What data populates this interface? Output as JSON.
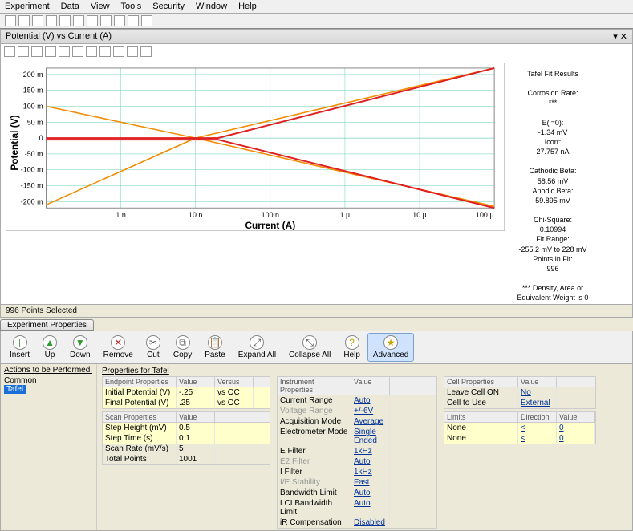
{
  "menu": [
    "Experiment",
    "Data",
    "View",
    "Tools",
    "Security",
    "Window",
    "Help"
  ],
  "chart_panel_title": "Potential (V) vs Current (A)",
  "chart_close": "▾ ✕",
  "status_points": "996 Points Selected",
  "chart_data": {
    "type": "line",
    "title": "",
    "xlabel": "Current (A)",
    "ylabel": "Potential (V)",
    "x_ticks": [
      "1 n",
      "10 n",
      "100 n",
      "1 µ",
      "10 µ",
      "100 µ"
    ],
    "y_ticks": [
      "200 m",
      "150 m",
      "100 m",
      "50 m",
      "0",
      "-50 m",
      "-100 m",
      "-150 m",
      "-200 m"
    ],
    "ylim": [
      -0.25,
      0.25
    ],
    "xscale": "log",
    "series": [
      {
        "name": "Tafel data (orange)",
        "color": "#f28c00",
        "shape": "v-down",
        "apex_x": "~30 n",
        "apex_y": 0,
        "left_end_y": 0.1,
        "right_end_y": 0.24,
        "left_end_y_neg": -0.23,
        "right_end_y_neg": -0.24
      },
      {
        "name": "Tafel fit (red)",
        "color": "#e02020",
        "shape": "v-down",
        "apex_x": "~40 n",
        "apex_y": 0,
        "left_flat_y": 0,
        "right_end_y": 0.24,
        "right_end_y_neg": -0.24
      }
    ]
  },
  "results": {
    "header": "Tafel Fit Results",
    "items": [
      {
        "l": "Corrosion Rate:",
        "v": "***"
      },
      {
        "l": "E(i=0):",
        "v": "-1.34 mV"
      },
      {
        "l": "Icorr:",
        "v": "27.757 nA"
      },
      {
        "l": "Cathodic Beta:",
        "v": "58.56 mV"
      },
      {
        "l": "Anodic Beta:",
        "v": "59.895 mV"
      },
      {
        "l": "Chi-Square:",
        "v": "0.10994"
      },
      {
        "l": "Fit Range:",
        "v": "-255.2 mV to 228 mV"
      },
      {
        "l": "Points in Fit:",
        "v": "996"
      }
    ],
    "footnote": "*** Density, Area or Equivalent Weight is 0"
  },
  "props_tab": "Experiment Properties",
  "props_buttons": [
    {
      "label": "Insert",
      "icon": "＋",
      "c": "#2a9c2a"
    },
    {
      "label": "Up",
      "icon": "▲",
      "c": "#2a9c2a"
    },
    {
      "label": "Down",
      "icon": "▼",
      "c": "#2a9c2a"
    },
    {
      "label": "Remove",
      "icon": "✕",
      "c": "#c02020"
    },
    {
      "label": "Cut",
      "icon": "✂",
      "c": "#555"
    },
    {
      "label": "Copy",
      "icon": "⧉",
      "c": "#555"
    },
    {
      "label": "Paste",
      "icon": "📋",
      "c": "#555"
    },
    {
      "label": "Expand All",
      "icon": "⤢",
      "c": "#555"
    },
    {
      "label": "Collapse All",
      "icon": "⤡",
      "c": "#555"
    },
    {
      "label": "Help",
      "icon": "?",
      "c": "#c9a400"
    },
    {
      "label": "Advanced",
      "icon": "★",
      "c": "#c9a400",
      "sel": true
    }
  ],
  "tree": {
    "header": "Actions to be Performed:",
    "root": "Common",
    "child": "Tafel"
  },
  "properties_title": "Properties for Tafel",
  "groups": {
    "endpoint": {
      "header": "Endpoint Properties",
      "cols": [
        "Value",
        "Versus"
      ],
      "rows": [
        {
          "n": "Initial Potential (V)",
          "v": "-.25",
          "x": "vs OC",
          "e": true
        },
        {
          "n": "Final Potential (V)",
          "v": ".25",
          "x": "vs OC",
          "e": true
        }
      ]
    },
    "scan": {
      "header": "Scan Properties",
      "cols": [
        "Value"
      ],
      "rows": [
        {
          "n": "Step Height (mV)",
          "v": "0.5",
          "e": true
        },
        {
          "n": "Step Time (s)",
          "v": "0.1",
          "e": true
        },
        {
          "n": "Scan Rate (mV/s)",
          "v": "5"
        },
        {
          "n": "Total Points",
          "v": "1001"
        }
      ]
    },
    "instr": {
      "header": "Instrument Properties",
      "cols": [
        "Value"
      ],
      "rows": [
        {
          "n": "Current Range",
          "v": "Auto",
          "link": true
        },
        {
          "n": "Voltage Range",
          "v": "+/-6V",
          "link": true,
          "dis": true
        },
        {
          "n": "Acquisition Mode",
          "v": "Average",
          "link": true
        },
        {
          "n": "Electrometer Mode",
          "v": "Single Ended",
          "link": true
        },
        {
          "n": "E Filter",
          "v": "1kHz",
          "link": true
        },
        {
          "n": "E2 Filter",
          "v": "Auto",
          "link": true,
          "dis": true
        },
        {
          "n": "I Filter",
          "v": "1kHz",
          "link": true
        },
        {
          "n": "I/E Stability",
          "v": "Fast",
          "link": true,
          "dis": true
        },
        {
          "n": "Bandwidth Limit",
          "v": "Auto",
          "link": true
        },
        {
          "n": "LCI Bandwidth Limit",
          "v": "Auto",
          "link": true
        },
        {
          "n": "iR Compensation",
          "v": "Disabled",
          "link": true
        }
      ]
    },
    "cell": {
      "header": "Cell Properties",
      "cols": [
        "Value"
      ],
      "rows": [
        {
          "n": "Leave Cell ON",
          "v": "No",
          "link": true
        },
        {
          "n": "Cell to Use",
          "v": "External",
          "link": true
        }
      ]
    },
    "limits": {
      "header": "Limits",
      "cols": [
        "Direction",
        "Value"
      ],
      "rows": [
        {
          "n": "None",
          "v": "<",
          "x": "0",
          "link": true,
          "e": true
        },
        {
          "n": "None",
          "v": "<",
          "x": "0",
          "link": true,
          "e": true
        }
      ]
    }
  }
}
